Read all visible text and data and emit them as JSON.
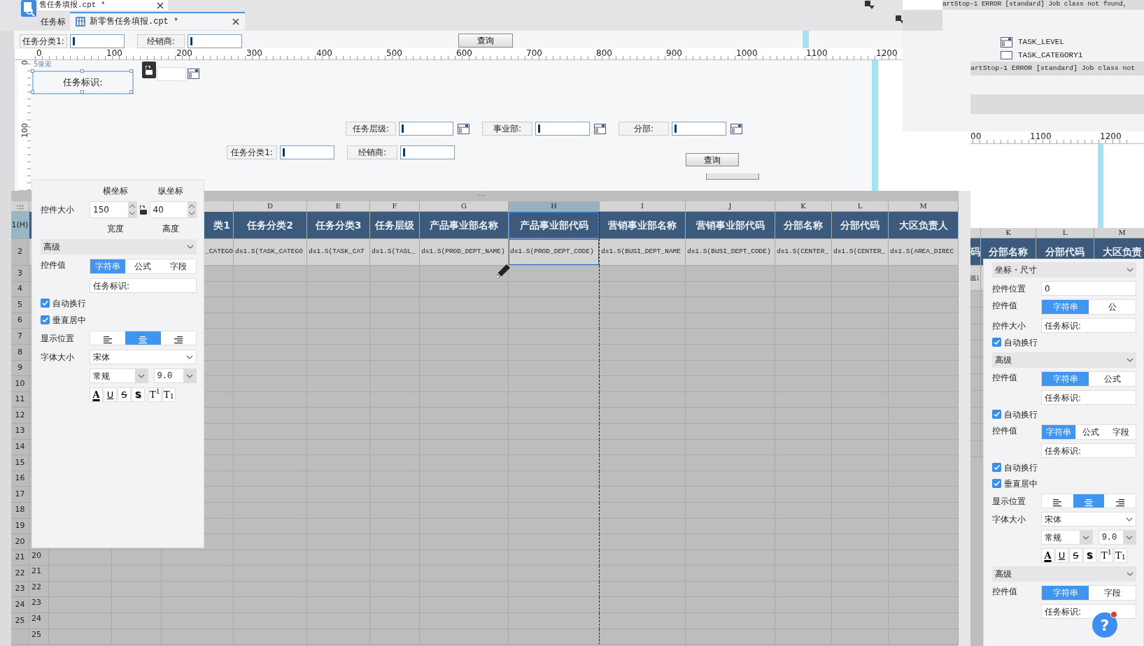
{
  "tabs": [
    {
      "label": "售任务填报.cpt *",
      "selected": false
    },
    {
      "label": "新零售任务填报.cpt *",
      "selected": true
    }
  ],
  "hidden_tab_text": "任务标",
  "top_form": {
    "items": [
      {
        "kind": "label",
        "text": "任务分类1:"
      },
      {
        "kind": "field"
      },
      {
        "kind": "label",
        "text": "经销商:"
      },
      {
        "kind": "field"
      }
    ],
    "button": "查询"
  },
  "ruler": [
    "0",
    "100",
    "200",
    "300",
    "400",
    "500",
    "600",
    "700",
    "800",
    "900",
    "1000",
    "1100",
    "1200"
  ],
  "design": {
    "vruler": [
      "0",
      "100"
    ],
    "hint": "5像素",
    "label": {
      "text": "任务标识:",
      "selected": true,
      "locked": false
    },
    "widget_rows": [
      [
        {
          "kind": "label",
          "text": "任务层级:"
        },
        {
          "kind": "field"
        },
        {
          "kind": "picker"
        },
        {
          "kind": "label",
          "text": "事业部:"
        },
        {
          "kind": "field"
        },
        {
          "kind": "picker"
        },
        {
          "kind": "label",
          "text": "分部:"
        },
        {
          "kind": "field"
        },
        {
          "kind": "picker"
        }
      ],
      [
        {
          "kind": "label",
          "text": "任务分类1:"
        },
        {
          "kind": "field"
        },
        {
          "kind": "label",
          "text": "经销商:"
        },
        {
          "kind": "field"
        }
      ]
    ],
    "button": "查询"
  },
  "sheet": {
    "columns": [
      {
        "title": "类1",
        "formula": "_CATEGO",
        "selected": false
      },
      {
        "letter": "D",
        "title": "任务分类2",
        "formula": "ds1.S(TASK_CATEGO",
        "selected": false
      },
      {
        "letter": "E",
        "title": "任务分类3",
        "formula": "ds1.S(TASK_CAT",
        "selected": false
      },
      {
        "letter": "F",
        "title": "任务层级",
        "formula": "ds1.S(TASL_",
        "selected": false
      },
      {
        "letter": "G",
        "title": "产品事业部名称",
        "formula": "ds1.S(PROD_DEPT_NAME)",
        "selected": false
      },
      {
        "letter": "H",
        "title": "产品事业部代码",
        "formula": "ds1.S(PROD_DEPT_CODE)",
        "selected": true
      },
      {
        "letter": "I",
        "title": "营销事业部名称",
        "formula": "ds1.S(BUSI_DEPT_NAME",
        "selected": false
      },
      {
        "letter": "J",
        "title": "营销事业部代码",
        "formula": "ds1.S(BUSI_DEPT_CODE)",
        "selected": false
      },
      {
        "letter": "K",
        "title": "分部名称",
        "formula": "ds1.S(CENTER_",
        "selected": false
      },
      {
        "letter": "L",
        "title": "分部代码",
        "formula": "ds1.S(CENTER_",
        "selected": false
      },
      {
        "letter": "M",
        "title": "大区负责人",
        "formula": "ds1.S(AREA_DIREC",
        "selected": false
      }
    ],
    "rows": [
      {
        "label": "1(H)"
      },
      {
        "label": "2"
      },
      {
        "label": "3"
      },
      {
        "label": "4"
      },
      {
        "label": "5"
      },
      {
        "label": "6"
      },
      {
        "label": "7"
      },
      {
        "label": "8"
      },
      {
        "label": "9"
      },
      {
        "label": "10"
      },
      {
        "label": "11"
      },
      {
        "label": "12"
      },
      {
        "label": "13"
      },
      {
        "label": "14"
      },
      {
        "label": "15"
      },
      {
        "label": "16"
      },
      {
        "label": "17"
      },
      {
        "label": "18"
      },
      {
        "label": "19"
      },
      {
        "label": "20"
      },
      {
        "label": "21",
        "inner": "20"
      },
      {
        "label": "22",
        "inner": "21"
      },
      {
        "label": "23",
        "inner": "22"
      },
      {
        "label": "24",
        "inner": "23"
      },
      {
        "label": "25",
        "inner": "24"
      },
      {
        "inner": "25"
      }
    ]
  },
  "left_panel": [
    {
      "kind": "captions",
      "texts": [
        "横坐标",
        "纵坐标"
      ]
    },
    {
      "kind": "spinners",
      "label": "控件大小",
      "values": [
        "150",
        "40"
      ],
      "locked": false
    },
    {
      "kind": "captions",
      "texts": [
        "宽度",
        "高度"
      ]
    },
    {
      "kind": "header",
      "label": "高级"
    },
    {
      "kind": "modes",
      "label": "控件值",
      "options": [
        {
          "label": "字符串",
          "selected": true
        },
        {
          "label": "公式",
          "selected": false
        },
        {
          "label": "字段",
          "selected": false
        }
      ]
    },
    {
      "kind": "field",
      "value": "任务标识:"
    },
    {
      "kind": "check",
      "label": "自动换行",
      "checked": true
    },
    {
      "kind": "check",
      "label": "垂直居中",
      "checked": true
    },
    {
      "kind": "align",
      "label": "显示位置",
      "options": [
        {
          "kind": "left",
          "selected": false
        },
        {
          "kind": "center",
          "selected": true
        },
        {
          "kind": "right",
          "selected": false
        }
      ]
    },
    {
      "kind": "select",
      "label": "字体大小",
      "value": "宋体"
    },
    {
      "kind": "font",
      "style": "常规",
      "size": "9.0"
    },
    {
      "kind": "format",
      "buttons": [
        {
          "kind": "color",
          "text": "A"
        },
        {
          "kind": "underline",
          "text": "U"
        },
        {
          "kind": "strike",
          "text": "S"
        },
        {
          "kind": "shadow",
          "text": "S"
        },
        {
          "kind": "sup",
          "text": "T$^{1}$"
        },
        {
          "kind": "sub",
          "text": "T$_{1}$"
        }
      ]
    }
  ],
  "console": {
    "logs": [
      "artStop-1 ERROR [standard] Job class not found,",
      "artStop-1 ERROR [standard] Job class not"
    ],
    "tree": [
      {
        "kind": "combo",
        "label": "TASK_LEVEL"
      },
      {
        "kind": "text",
        "label": "TASK_CATEGORY1"
      }
    ]
  },
  "mini": {
    "ruler": [
      "00",
      "1100",
      "1200"
    ],
    "columns": [
      {
        "title": "码"
      },
      {
        "letter": "K",
        "title": "分部名称"
      },
      {
        "letter": "L",
        "title": "分部代码"
      },
      {
        "letter": "M",
        "title": "大区负责"
      }
    ],
    "formula": "DE)"
  },
  "right_panel": [
    {
      "kind": "header",
      "label": "坐标・尺寸"
    },
    {
      "kind": "field",
      "label": "控件位置",
      "value": "0"
    },
    {
      "kind": "modes",
      "label": "控件值",
      "options": [
        {
          "label": "字符串",
          "selected": true
        },
        {
          "label": "公",
          "selected": false
        }
      ]
    },
    {
      "kind": "field",
      "label": "控件大小",
      "value": "任务标识:"
    },
    {
      "kind": "check",
      "label": "自动换行",
      "checked": true
    },
    {
      "kind": "header",
      "label": "高级"
    },
    {
      "kind": "modes",
      "label": "控件值",
      "options": [
        {
          "label": "字符串",
          "selected": true
        },
        {
          "label": "公式",
          "selected": false
        }
      ]
    },
    {
      "kind": "field",
      "value": "任务标识:"
    },
    {
      "kind": "check",
      "label": "自动换行",
      "checked": true
    },
    {
      "kind": "modes",
      "label": "控件值",
      "options": [
        {
          "label": "字符串",
          "selected": true
        },
        {
          "label": "公式",
          "selected": false
        },
        {
          "label": "字段",
          "selected": false
        }
      ]
    },
    {
      "kind": "field",
      "value": "任务标识:"
    },
    {
      "kind": "check",
      "label": "自动换行",
      "checked": true
    },
    {
      "kind": "check",
      "label": "垂直居中",
      "checked": true
    },
    {
      "kind": "align",
      "label": "显示位置",
      "options": [
        {
          "kind": "left",
          "selected": false
        },
        {
          "kind": "center",
          "selected": true
        },
        {
          "kind": "right",
          "selected": false
        }
      ]
    },
    {
      "kind": "select",
      "label": "字体大小",
      "value": "宋体"
    },
    {
      "kind": "font",
      "style": "常规",
      "size": "9.0"
    },
    {
      "kind": "format",
      "buttons": [
        {
          "kind": "color",
          "text": "A"
        },
        {
          "kind": "underline",
          "text": "U"
        },
        {
          "kind": "strike",
          "text": "S"
        },
        {
          "kind": "shadow",
          "text": "S"
        },
        {
          "kind": "sup",
          "text": "T$^{1}$"
        },
        {
          "kind": "sub",
          "text": "T$_{1}$"
        }
      ]
    },
    {
      "kind": "header",
      "label": "高级"
    },
    {
      "kind": "modes",
      "label": "控件值",
      "options": [
        {
          "label": "字符串",
          "selected": true
        },
        {
          "label": "字段",
          "selected": false
        }
      ]
    },
    {
      "kind": "field",
      "value": "任务标识:"
    }
  ],
  "help": "?"
}
